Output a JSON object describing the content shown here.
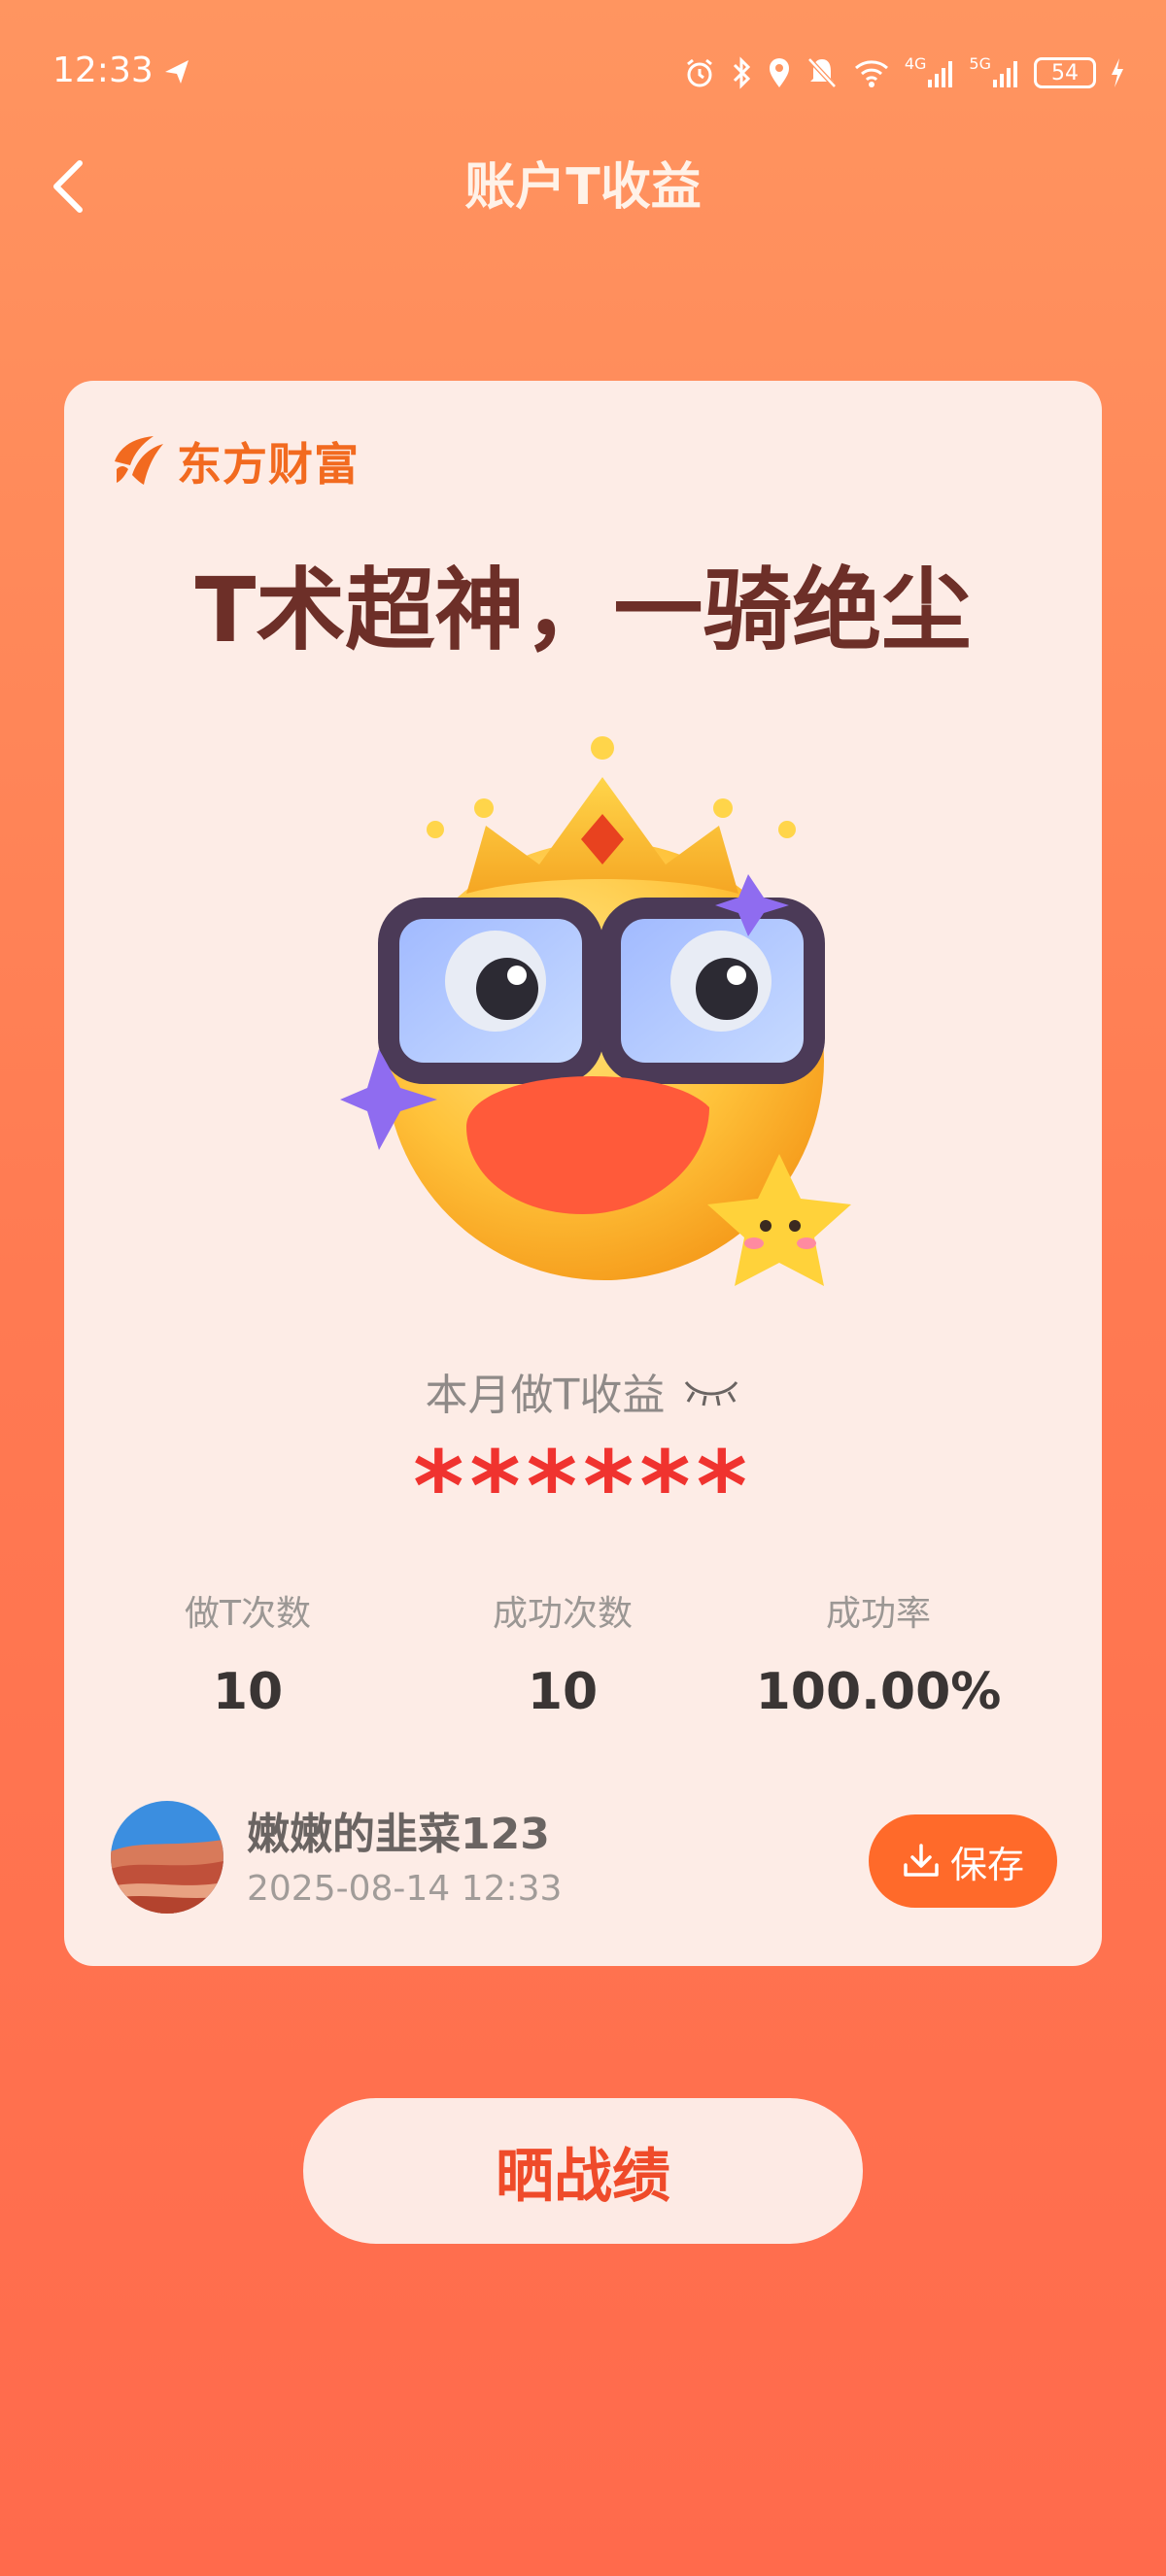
{
  "status_bar": {
    "time": "12:33",
    "network_4g": "4G",
    "network_5g": "5G",
    "battery": "54",
    "icons": [
      "navigation-icon",
      "alarm-icon",
      "bluetooth-icon",
      "location-icon",
      "mute-icon",
      "wifi-icon",
      "signal-icon",
      "charging-icon"
    ]
  },
  "header": {
    "title": "账户T收益",
    "back_icon": "chevron-left-icon"
  },
  "card": {
    "brand": "东方财富",
    "headline": "T术超神，一骑绝尘",
    "earnings_label": "本月做T收益",
    "earnings_value": "******",
    "stats": [
      {
        "label": "做T次数",
        "value": "10"
      },
      {
        "label": "成功次数",
        "value": "10"
      },
      {
        "label": "成功率",
        "value": "100.00%"
      }
    ],
    "user": {
      "name": "嫩嫩的韭菜123",
      "date": "2025-08-14 12:33"
    },
    "save_label": "保存"
  },
  "share_label": "晒战绩",
  "colors": {
    "accent": "#ff6a2a",
    "headline": "#6d2f28",
    "masked": "#f0332f"
  }
}
